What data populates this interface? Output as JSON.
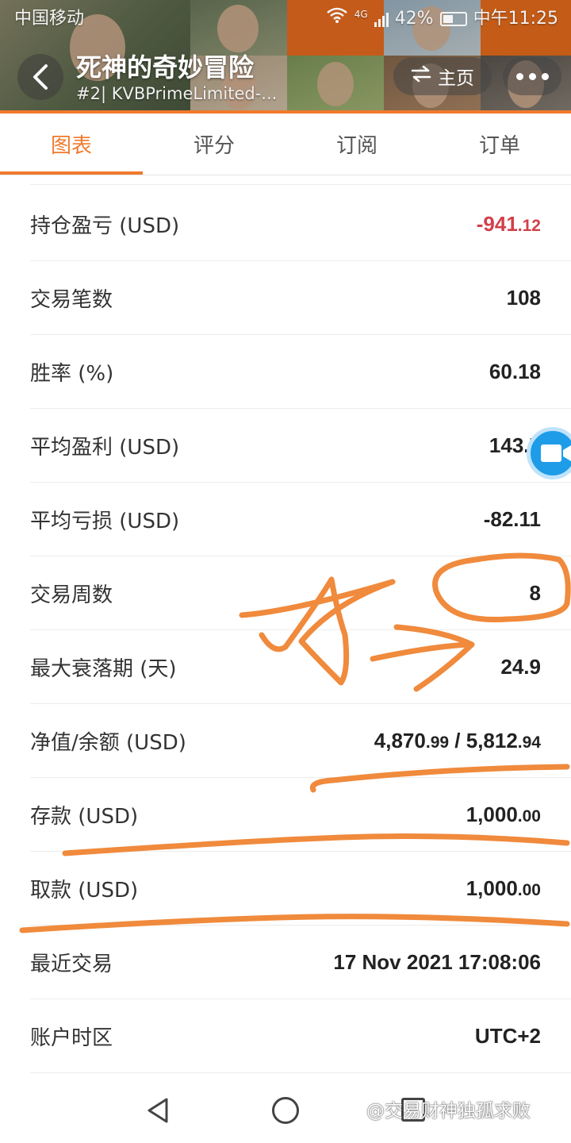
{
  "status_bar": {
    "carrier": "中国移动",
    "battery": "42%",
    "time": "中午11:25",
    "network": "4G"
  },
  "header": {
    "title": "死神的奇妙冒险",
    "subtitle": "#2| KVBPrimeLimited-...",
    "home_label": "主页"
  },
  "tabs": [
    {
      "label": "图表",
      "active": true
    },
    {
      "label": "评分",
      "active": false
    },
    {
      "label": "订阅",
      "active": false
    },
    {
      "label": "订单",
      "active": false
    }
  ],
  "rows": [
    {
      "label": "持仓盈亏 (USD)",
      "value_main": "-941",
      "value_dec": ".12",
      "negative": true
    },
    {
      "label": "交易笔数",
      "value_main": "108",
      "value_dec": ""
    },
    {
      "label": "胜率 (%)",
      "value_main": "60.18",
      "value_dec": ""
    },
    {
      "label": "平均盈利 (USD)",
      "value_main": "143.7",
      "value_dec": ""
    },
    {
      "label": "平均亏损 (USD)",
      "value_main": "-82.11",
      "value_dec": ""
    },
    {
      "label": "交易周数",
      "value_main": "8",
      "value_dec": ""
    },
    {
      "label": "最大衰落期 (天)",
      "value_main": "24.9",
      "value_dec": ""
    },
    {
      "label": "净值/余额 (USD)",
      "value_main": "4,870",
      "value_dec": ".99",
      "value_main2": " / 5,812",
      "value_dec2": ".94"
    },
    {
      "label": "存款 (USD)",
      "value_main": "1,000",
      "value_dec": ".00"
    },
    {
      "label": "取款 (USD)",
      "value_main": "1,000",
      "value_dec": ".00"
    },
    {
      "label": "最近交易",
      "value_main": "17 Nov 2021 17:08:06",
      "value_dec": ""
    },
    {
      "label": "账户时区",
      "value_main": "UTC+2",
      "value_dec": ""
    }
  ],
  "watermark": "@交易财神独孤求败",
  "colors": {
    "accent": "#f07a2c",
    "negative": "#d2404a",
    "annotation": "#f08a3c",
    "float_button": "#1e9ce8"
  }
}
